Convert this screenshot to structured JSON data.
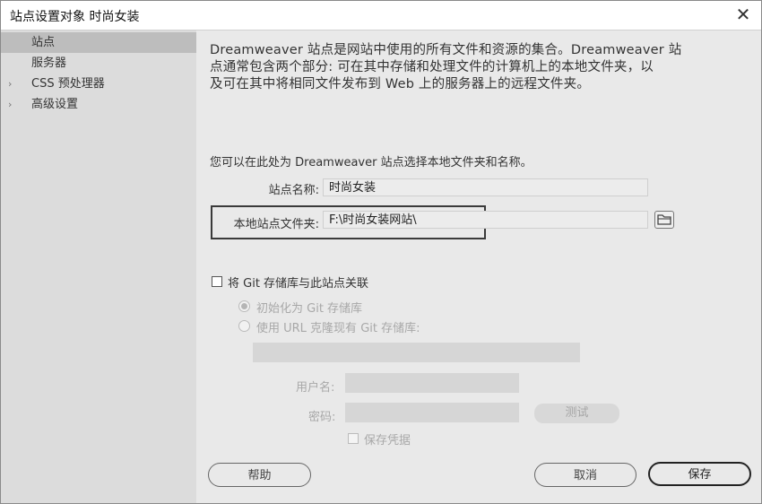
{
  "window": {
    "title": "站点设置对象 时尚女装",
    "close_glyph": "✕"
  },
  "sidebar": {
    "items": [
      {
        "label": "站点",
        "active": true,
        "expandable": false
      },
      {
        "label": "服务器",
        "active": false,
        "expandable": false
      },
      {
        "label": "CSS 预处理器",
        "active": false,
        "expandable": true
      },
      {
        "label": "高级设置",
        "active": false,
        "expandable": true
      }
    ],
    "chevron_glyph": "›"
  },
  "main": {
    "description_lines": [
      "Dreamweaver 站点是网站中使用的所有文件和资源的集合。Dreamweaver 站",
      "点通常包含两个部分: 可在其中存储和处理文件的计算机上的本地文件夹，以",
      "及可在其中将相同文件发布到 Web 上的服务器上的远程文件夹。"
    ],
    "intro": "您可以在此处为 Dreamweaver 站点选择本地文件夹和名称。",
    "site_name_label": "站点名称:",
    "site_name_value": "时尚女装",
    "local_folder_label": "本地站点文件夹:",
    "local_folder_value": "F:\\时尚女装网站\\",
    "folder_icon": "folder-icon"
  },
  "git": {
    "associate_label": "将 Git 存储库与此站点关联",
    "associate_checked": false,
    "init_label": "初始化为 Git 存储库",
    "clone_label": "使用 URL 克隆现有 Git 存储库:",
    "url_value": "",
    "username_label": "用户名:",
    "username_value": "",
    "password_label": "密码:",
    "password_value": "",
    "test_button": "测试",
    "save_credentials_label": "保存凭据"
  },
  "footer": {
    "help_button": "帮助",
    "cancel_button": "取消",
    "save_button": "保存"
  }
}
